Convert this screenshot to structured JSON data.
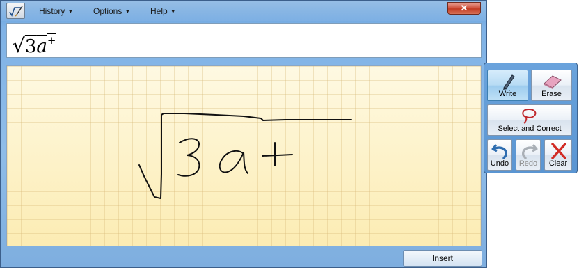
{
  "menu": {
    "history": "History",
    "options": "Options",
    "help": "Help"
  },
  "window": {
    "close_glyph": "✕"
  },
  "preview": {
    "radical": "√",
    "digit": "3",
    "variable": "a",
    "superscript": "+"
  },
  "toolbar": {
    "write": "Write",
    "erase": "Erase",
    "select_correct": "Select and Correct",
    "undo": "Undo",
    "redo": "Redo",
    "clear": "Clear"
  },
  "insert_label": "Insert",
  "icons": {
    "app": "math-input-icon",
    "write": "pen-icon",
    "erase": "eraser-icon",
    "select": "lasso-icon",
    "undo": "undo-arrow-icon",
    "redo": "redo-arrow-icon",
    "clear": "red-x-icon"
  },
  "colors": {
    "frame": "#7fb2e6",
    "pad": "#fdf2c7",
    "active_button": "#b7dbf4",
    "close": "#c23b22"
  }
}
